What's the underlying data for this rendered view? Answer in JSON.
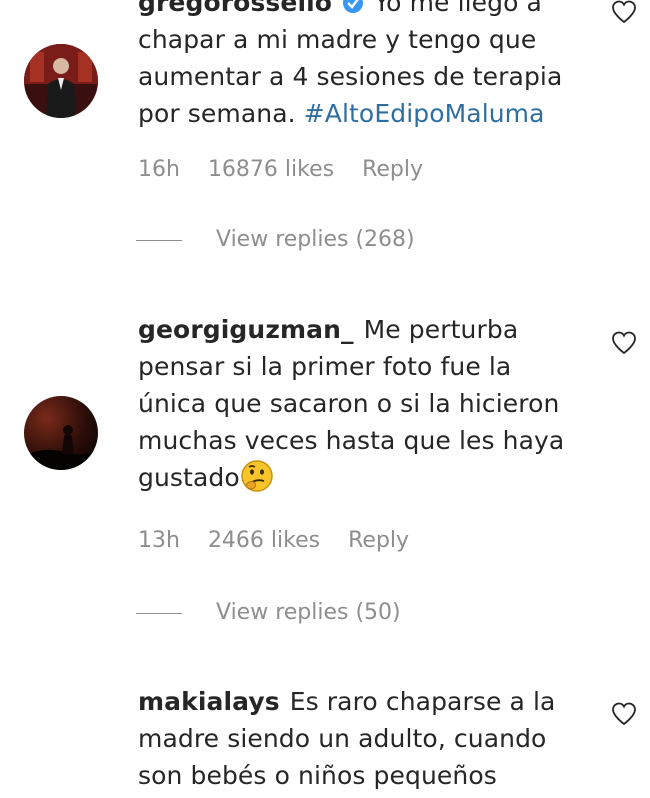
{
  "comments": [
    {
      "username": "gregorossello",
      "verified": true,
      "lines": [
        "Yo me llegó a",
        "chapar a mi madre y tengo que",
        "aumentar a 4 sesiones de terapia",
        "por semana."
      ],
      "hashtag": "#AltoEdipoMaluma",
      "time": "16h",
      "likes": "16876 likes",
      "reply_label": "Reply",
      "view_replies": "View replies (268)",
      "avatar": "person-in-suit-avatar"
    },
    {
      "username": "georgiguzman_",
      "lines": [
        "Me perturba",
        "pensar si la primer foto fue la",
        "única que sacaron o si la hicieron",
        "muchas veces hasta que les haya",
        "gustado"
      ],
      "emoji": "thinking-face-icon",
      "time": "13h",
      "likes": "2466 likes",
      "reply_label": "Reply",
      "view_replies": "View replies (50)",
      "avatar": "sunset-silhouette-avatar"
    },
    {
      "username": "makialays",
      "lines": [
        "Es raro chaparse a la",
        "madre siendo un adulto, cuando",
        "son bebés o niños pequeños"
      ],
      "avatar": "none"
    }
  ],
  "icons": {
    "like": "heart-outline-icon",
    "verified": "verified-badge-icon"
  },
  "colors": {
    "text": "#262626",
    "muted": "#8e8e8e",
    "hashtag": "#2f6f9f",
    "verified": "#3897f0"
  }
}
